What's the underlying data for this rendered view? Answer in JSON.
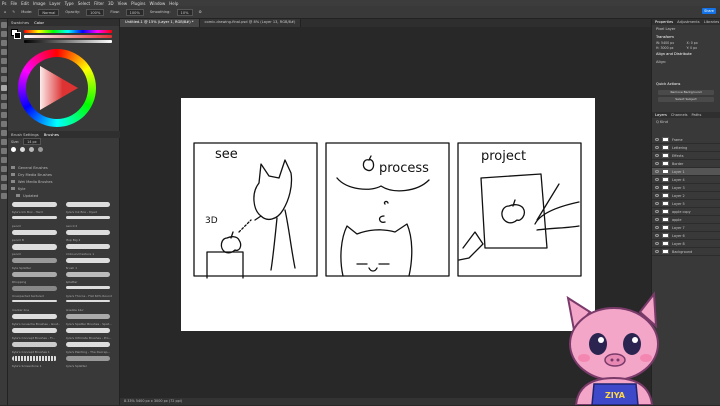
{
  "menu": [
    "Ps",
    "File",
    "Edit",
    "Image",
    "Layer",
    "Type",
    "Select",
    "Filter",
    "3D",
    "View",
    "Plugins",
    "Window",
    "Help"
  ],
  "options_bar": {
    "mode_label": "Mode:",
    "mode_value": "Normal",
    "opacity_label": "Opacity:",
    "opacity_value": "100%",
    "flow_label": "Flow:",
    "flow_value": "100%",
    "smoothing_label": "Smoothing:",
    "smoothing_value": "10%"
  },
  "share_label": "Share",
  "left_tabs": [
    "Swatches",
    "Color"
  ],
  "brush_tabs": [
    "Brush Settings",
    "Brushes"
  ],
  "brush_size": "14 px",
  "brush_folders": [
    "General Brushes",
    "Dry Media Brushes",
    "Wet Media Brushes",
    "Kyle",
    "Updated"
  ],
  "brushes": [
    {
      "name": "Kyle's Ink Box - Hard"
    },
    {
      "name": "Kyle's Ink Box - Dyed"
    },
    {
      "name": "pencil"
    },
    {
      "name": "pencil 2"
    },
    {
      "name": "pencil B"
    },
    {
      "name": "Mop Big 2"
    },
    {
      "name": "pencil"
    },
    {
      "name": "Inkbound texture 1"
    },
    {
      "name": "Kyle Splatter"
    },
    {
      "name": "Brush 1"
    },
    {
      "name": "Rhopping"
    },
    {
      "name": "Splatter"
    },
    {
      "name": "Unexpected textured"
    },
    {
      "name": "Kyle's Thorns - Flat 60% Round"
    },
    {
      "name": "marker line"
    },
    {
      "name": "pixelize blur"
    },
    {
      "name": "Kyle's Gouache Brushes - Gout..."
    },
    {
      "name": "Kyle's Spatter Brushes - Spat..."
    },
    {
      "name": "Kyle's Concept Brushes - Fl..."
    },
    {
      "name": "Kyle's Ultimate Brushes - Pro..."
    },
    {
      "name": "Kyle's Concept Brushes 1"
    },
    {
      "name": "Kyle's Painting - The Decrep..."
    },
    {
      "name": "Kyle's Screentone 1"
    },
    {
      "name": "Kyle's Splatter"
    }
  ],
  "doc_tabs": [
    {
      "label": "Untitled-1 @ 15% (Layer 1, RGB/8#) *",
      "active": true
    },
    {
      "label": "comic-drawing-final.psd @ 8% (Layer 13, RGB/8#)",
      "active": false
    }
  ],
  "canvas_text": {
    "panel1": "see",
    "panel1_note": "3D",
    "panel2": "process",
    "panel3": "project"
  },
  "status_text": "8.33%   5400 px x 3000 px (72 ppi)",
  "right_tabs": [
    "Properties",
    "Adjustments",
    "Libraries"
  ],
  "properties": {
    "doc_label": "Pixel Layer",
    "transform": "Transform",
    "w": "W: 5400 px",
    "h": "H: 3000 px",
    "x": "X: 0 px",
    "y": "Y: 0 px",
    "align": "Align and Distribute",
    "align_sub": "Align:",
    "quick": "Quick Actions",
    "btn1": "Remove Background",
    "btn2": "Select Subject"
  },
  "layer_tabs": [
    "Layers",
    "Channels",
    "Paths"
  ],
  "layer_filter": "Q Kind",
  "layers": [
    {
      "name": "Frame",
      "selected": false
    },
    {
      "name": "Lettering",
      "selected": false
    },
    {
      "name": "Effects",
      "selected": false
    },
    {
      "name": "Border",
      "selected": false
    },
    {
      "name": "Layer 1",
      "selected": true
    },
    {
      "name": "Layer 4",
      "selected": false
    },
    {
      "name": "Layer 3",
      "selected": false
    },
    {
      "name": "Layer 2",
      "selected": false
    },
    {
      "name": "Layer 5",
      "selected": false
    },
    {
      "name": "apple copy",
      "selected": false
    },
    {
      "name": "apple",
      "selected": false
    },
    {
      "name": "Layer 7",
      "selected": false
    },
    {
      "name": "Layer 6",
      "selected": false
    },
    {
      "name": "Layer 8",
      "selected": false
    },
    {
      "name": "Background",
      "selected": false
    }
  ],
  "sticker_text": "ZIYA",
  "colors": {
    "accent": "#1473e6",
    "bg": "#282828",
    "panel": "#393939",
    "pig": "#f3a6c8",
    "apron": "#3d49c9"
  }
}
